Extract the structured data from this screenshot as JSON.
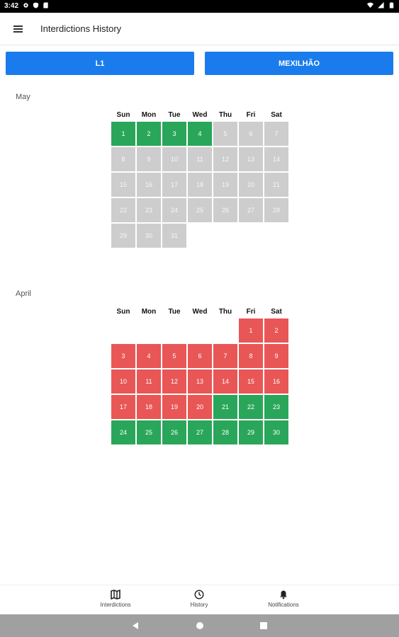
{
  "status_bar": {
    "time": "3:42"
  },
  "app_bar": {
    "title": "Interdictions History"
  },
  "buttons": {
    "left": "L1",
    "right": "MEXILHÃO"
  },
  "weekdays": [
    "Sun",
    "Mon",
    "Tue",
    "Wed",
    "Thu",
    "Fri",
    "Sat"
  ],
  "months": [
    {
      "name": "May",
      "days": [
        {
          "d": "1",
          "s": "green"
        },
        {
          "d": "2",
          "s": "green"
        },
        {
          "d": "3",
          "s": "green"
        },
        {
          "d": "4",
          "s": "green"
        },
        {
          "d": "5",
          "s": "gray"
        },
        {
          "d": "6",
          "s": "gray"
        },
        {
          "d": "7",
          "s": "gray"
        },
        {
          "d": "8",
          "s": "gray"
        },
        {
          "d": "9",
          "s": "gray"
        },
        {
          "d": "10",
          "s": "gray"
        },
        {
          "d": "11",
          "s": "gray"
        },
        {
          "d": "12",
          "s": "gray"
        },
        {
          "d": "13",
          "s": "gray"
        },
        {
          "d": "14",
          "s": "gray"
        },
        {
          "d": "15",
          "s": "gray"
        },
        {
          "d": "16",
          "s": "gray"
        },
        {
          "d": "17",
          "s": "gray"
        },
        {
          "d": "18",
          "s": "gray"
        },
        {
          "d": "19",
          "s": "gray"
        },
        {
          "d": "20",
          "s": "gray"
        },
        {
          "d": "21",
          "s": "gray"
        },
        {
          "d": "22",
          "s": "gray"
        },
        {
          "d": "23",
          "s": "gray"
        },
        {
          "d": "24",
          "s": "gray"
        },
        {
          "d": "25",
          "s": "gray"
        },
        {
          "d": "26",
          "s": "gray"
        },
        {
          "d": "27",
          "s": "gray"
        },
        {
          "d": "28",
          "s": "gray"
        },
        {
          "d": "29",
          "s": "gray"
        },
        {
          "d": "30",
          "s": "gray"
        },
        {
          "d": "31",
          "s": "gray"
        }
      ]
    },
    {
      "name": "April",
      "days": [
        {
          "d": "",
          "s": "blank"
        },
        {
          "d": "",
          "s": "blank"
        },
        {
          "d": "",
          "s": "blank"
        },
        {
          "d": "",
          "s": "blank"
        },
        {
          "d": "",
          "s": "blank"
        },
        {
          "d": "1",
          "s": "red"
        },
        {
          "d": "2",
          "s": "red"
        },
        {
          "d": "3",
          "s": "red"
        },
        {
          "d": "4",
          "s": "red"
        },
        {
          "d": "5",
          "s": "red"
        },
        {
          "d": "6",
          "s": "red"
        },
        {
          "d": "7",
          "s": "red"
        },
        {
          "d": "8",
          "s": "red"
        },
        {
          "d": "9",
          "s": "red"
        },
        {
          "d": "10",
          "s": "red"
        },
        {
          "d": "11",
          "s": "red"
        },
        {
          "d": "12",
          "s": "red"
        },
        {
          "d": "13",
          "s": "red"
        },
        {
          "d": "14",
          "s": "red"
        },
        {
          "d": "15",
          "s": "red"
        },
        {
          "d": "16",
          "s": "red"
        },
        {
          "d": "17",
          "s": "red"
        },
        {
          "d": "18",
          "s": "red"
        },
        {
          "d": "19",
          "s": "red"
        },
        {
          "d": "20",
          "s": "red"
        },
        {
          "d": "21",
          "s": "green"
        },
        {
          "d": "22",
          "s": "green"
        },
        {
          "d": "23",
          "s": "green"
        },
        {
          "d": "24",
          "s": "green"
        },
        {
          "d": "25",
          "s": "green"
        },
        {
          "d": "26",
          "s": "green"
        },
        {
          "d": "27",
          "s": "green"
        },
        {
          "d": "28",
          "s": "green"
        },
        {
          "d": "29",
          "s": "green"
        },
        {
          "d": "30",
          "s": "green"
        }
      ]
    }
  ],
  "bottom_nav": [
    {
      "label": "Interdictions",
      "icon": "map-icon"
    },
    {
      "label": "History",
      "icon": "clock-icon"
    },
    {
      "label": "Notifications",
      "icon": "bell-icon"
    }
  ],
  "colors": {
    "accent": "#1a7cec",
    "open": "#2aa65a",
    "closed": "#e95656",
    "future": "#cdcdcd"
  }
}
